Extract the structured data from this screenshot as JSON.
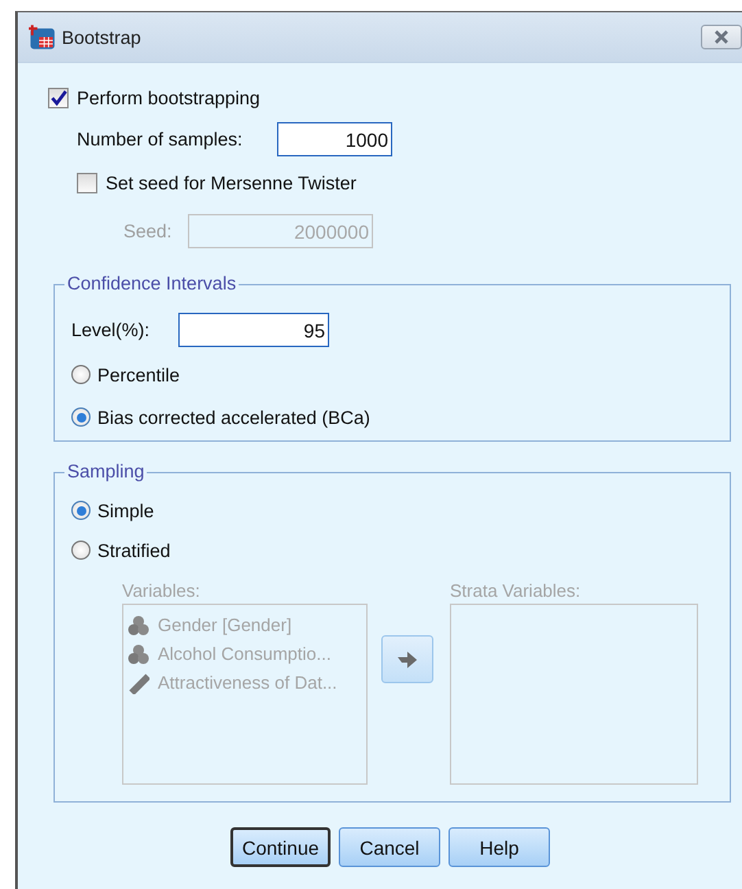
{
  "window": {
    "title": "Bootstrap"
  },
  "perform": {
    "label": "Perform bootstrapping",
    "checked": true
  },
  "samples": {
    "label": "Number of samples:",
    "value": "1000"
  },
  "seed_option": {
    "label": "Set seed for Mersenne Twister",
    "checked": false
  },
  "seed": {
    "label": "Seed:",
    "value": "2000000",
    "disabled": true
  },
  "confidence": {
    "title": "Confidence Intervals",
    "level_label": "Level(%):",
    "level_value": "95",
    "options": [
      {
        "label": "Percentile",
        "selected": false
      },
      {
        "label": "Bias corrected accelerated (BCa)",
        "selected": true
      }
    ]
  },
  "sampling": {
    "title": "Sampling",
    "options": [
      {
        "label": "Simple",
        "selected": true
      },
      {
        "label": "Stratified",
        "selected": false
      }
    ],
    "disabled": true,
    "variables_label": "Variables:",
    "variables": [
      {
        "name": "Gender [Gender]",
        "kind": "nominal"
      },
      {
        "name": "Alcohol Consumptio...",
        "kind": "nominal"
      },
      {
        "name": "Attractiveness of Dat...",
        "kind": "scale"
      }
    ],
    "strata_label": "Strata Variables:"
  },
  "buttons": [
    {
      "label": "Continue",
      "default": true
    },
    {
      "label": "Cancel",
      "default": false
    },
    {
      "label": "Help",
      "default": false
    }
  ]
}
